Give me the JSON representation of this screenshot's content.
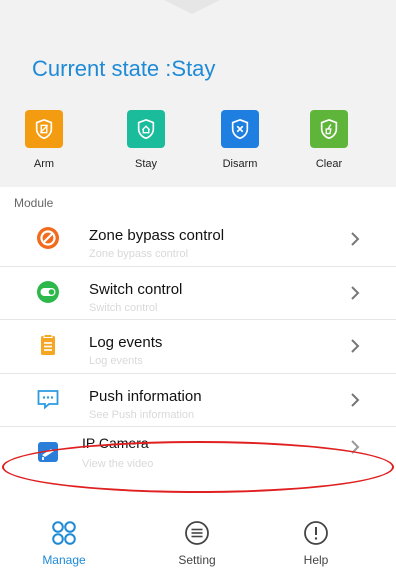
{
  "header": {
    "state_title": "Current state :Stay"
  },
  "actions": [
    {
      "label": "Arm",
      "icon": "arm-icon",
      "color": "#f39c12"
    },
    {
      "label": "Stay",
      "icon": "stay-icon",
      "color": "#1abc9c"
    },
    {
      "label": "Disarm",
      "icon": "disarm-icon",
      "color": "#1e7fe0"
    },
    {
      "label": "Clear",
      "icon": "clear-icon",
      "color": "#5fb53a"
    }
  ],
  "module": {
    "label": "Module",
    "items": [
      {
        "title": "Zone bypass control",
        "subtitle": "Zone bypass control",
        "icon": "prohibit-icon",
        "color": "#f26a1b"
      },
      {
        "title": "Switch control",
        "subtitle": "Switch control",
        "icon": "toggle-icon",
        "color": "#2db84c"
      },
      {
        "title": "Log events",
        "subtitle": "Log events",
        "icon": "clipboard-icon",
        "color": "#f5a623"
      },
      {
        "title": "Push information",
        "subtitle": "See Push information",
        "icon": "chat-icon",
        "color": "#2b9be0"
      },
      {
        "title": "IP Camera",
        "subtitle": "View the video",
        "icon": "camera-icon",
        "color": "#2a7ed8"
      }
    ]
  },
  "tabs": [
    {
      "label": "Manage",
      "icon": "grid-circles-icon",
      "active": true
    },
    {
      "label": "Setting",
      "icon": "menu-circle-icon",
      "active": false
    },
    {
      "label": "Help",
      "icon": "exclamation-circle-icon",
      "active": false
    }
  ],
  "colors": {
    "accent": "#1f8ad6",
    "highlight": "#e02020"
  }
}
